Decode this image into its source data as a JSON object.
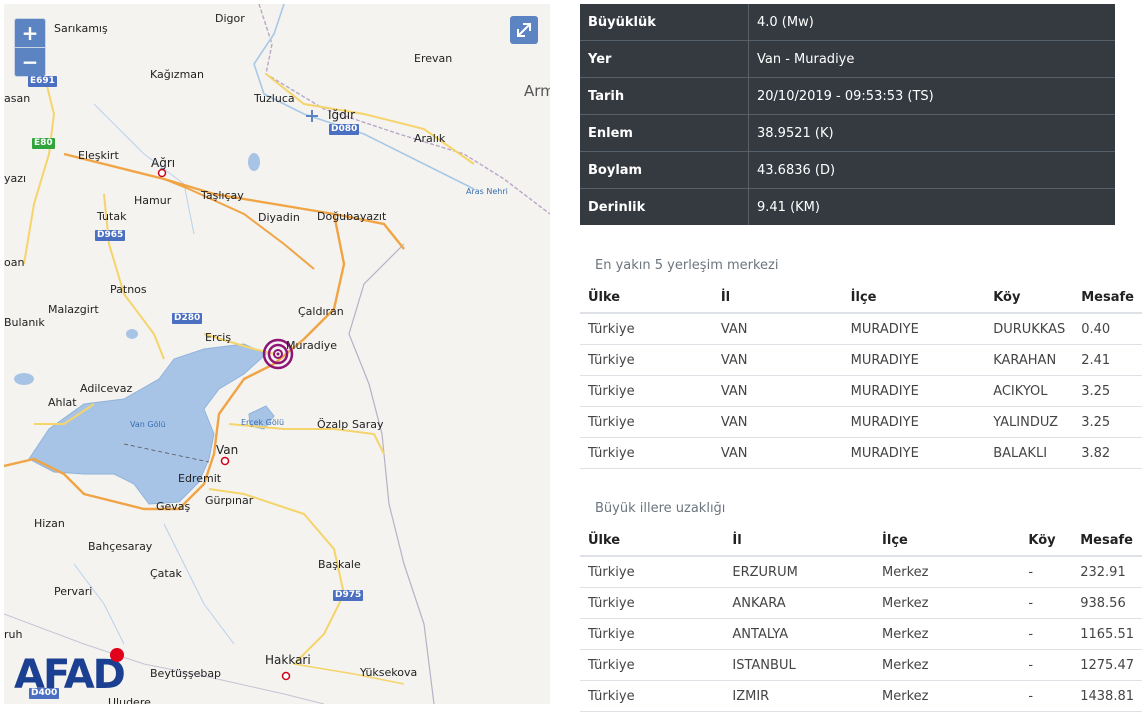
{
  "map": {
    "zoom_in_label": "+",
    "zoom_out_label": "−",
    "fullscreen_icon": "expand-icon",
    "logo_text": "AFAD",
    "places": [
      "Digor",
      "Sarıkamış",
      "Erevan",
      "Kağızman",
      "Tuzluca",
      "Iğdır",
      "Aralık",
      "Eleşkirt",
      "Ağrı",
      "Taşlıçay",
      "Hamur",
      "Diyadin",
      "Doğubayazıt",
      "Tutak",
      "Patnos",
      "Çaldıran",
      "Malazgirt",
      "Bulanık",
      "Erciş",
      "Muradiye",
      "Adilcevaz",
      "Ahlat",
      "Van",
      "Özalp",
      "Saray",
      "Edremit",
      "Gevaş",
      "Gürpınar",
      "Hizan",
      "Bahçesaray",
      "Çatak",
      "Pervari",
      "Başkale",
      "Hakkari",
      "Yüksekova",
      "Beytüşşebap",
      "Uludere"
    ],
    "big_places": [
      "Arm"
    ],
    "edge_labels": [
      "asan",
      "yazı",
      "oan",
      "ruh"
    ],
    "lakes": [
      "Van Gölü",
      "Erçek Gölü"
    ],
    "river": "Aras Nehri",
    "shields": [
      "E691",
      "E80",
      "D080",
      "D965",
      "D280",
      "D975",
      "D400"
    ]
  },
  "details": {
    "rows": [
      {
        "key": "Büyüklük",
        "value": "4.0 (Mw)"
      },
      {
        "key": "Yer",
        "value": "Van - Muradiye"
      },
      {
        "key": "Tarih",
        "value": "20/10/2019 - 09:53:53 (TS)"
      },
      {
        "key": "Enlem",
        "value": "38.9521 (K)"
      },
      {
        "key": "Boylam",
        "value": "43.6836 (D)"
      },
      {
        "key": "Derinlik",
        "value": "9.41 (KM)"
      }
    ]
  },
  "nearest": {
    "title": "En yakın 5 yerleşim merkezi",
    "headers": [
      "Ülke",
      "İl",
      "İlçe",
      "Köy",
      "Mesafe"
    ],
    "rows": [
      [
        "Türkiye",
        "VAN",
        "MURADIYE",
        "DURUKKAS",
        "0.40"
      ],
      [
        "Türkiye",
        "VAN",
        "MURADIYE",
        "KARAHAN",
        "2.41"
      ],
      [
        "Türkiye",
        "VAN",
        "MURADIYE",
        "ACIKYOL",
        "3.25"
      ],
      [
        "Türkiye",
        "VAN",
        "MURADIYE",
        "YALINDUZ",
        "3.25"
      ],
      [
        "Türkiye",
        "VAN",
        "MURADIYE",
        "BALAKLI",
        "3.82"
      ]
    ]
  },
  "cities": {
    "title": "Büyük illere uzaklığı",
    "headers": [
      "Ülke",
      "İl",
      "İlçe",
      "Köy",
      "Mesafe"
    ],
    "rows": [
      [
        "Türkiye",
        "ERZURUM",
        "Merkez",
        "-",
        "232.91"
      ],
      [
        "Türkiye",
        "ANKARA",
        "Merkez",
        "-",
        "938.56"
      ],
      [
        "Türkiye",
        "ANTALYA",
        "Merkez",
        "-",
        "1165.51"
      ],
      [
        "Türkiye",
        "ISTANBUL",
        "Merkez",
        "-",
        "1275.47"
      ],
      [
        "Türkiye",
        "IZMIR",
        "Merkez",
        "-",
        "1438.81"
      ]
    ]
  }
}
